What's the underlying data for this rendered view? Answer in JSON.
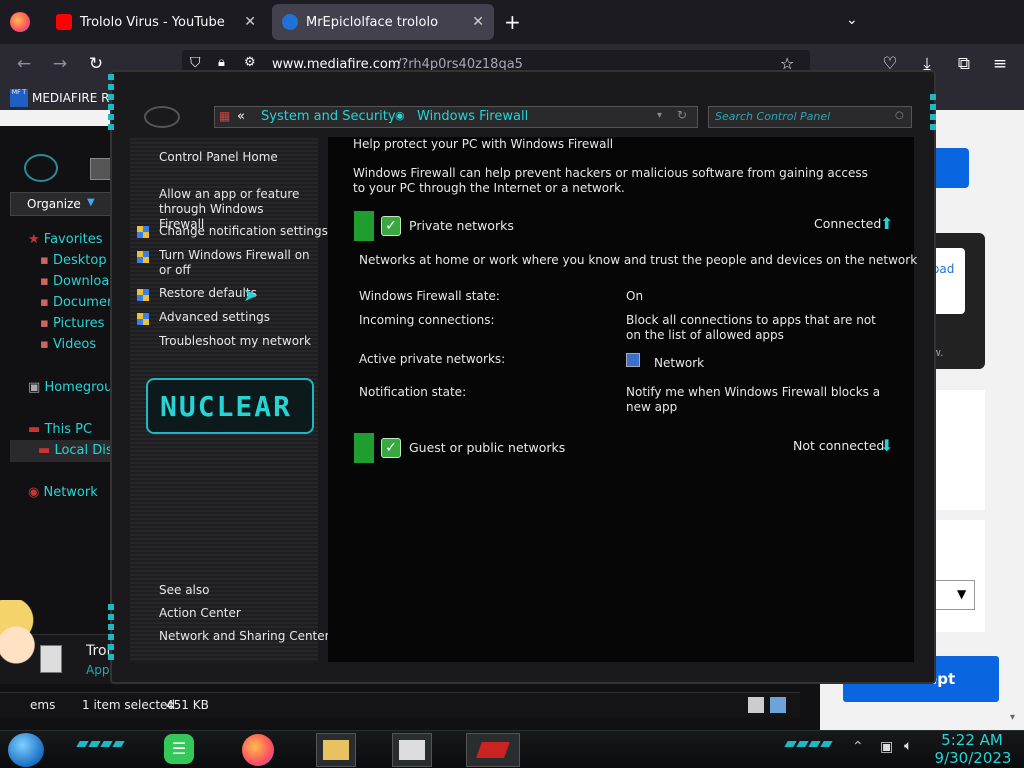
{
  "browser": {
    "tabs": [
      {
        "title": "Trololo Virus - YouTube",
        "icon": "youtube-icon",
        "active": false
      },
      {
        "title": "MrEpiclolface trololo",
        "icon": "mediafire-icon",
        "active": true
      }
    ],
    "url_domain": "www.mediafire.com",
    "url_path": "/?rh4p0rs40z18qa5",
    "bookmark": "MEDIAFIRE RO",
    "bookmark_icon": "MF T"
  },
  "explorer": {
    "organize": "Organize",
    "nav": [
      {
        "label": "Favorites",
        "icon": "star-icon"
      },
      {
        "label": "Desktop",
        "icon": "desktop-icon"
      },
      {
        "label": "Downloa",
        "icon": "download-icon"
      },
      {
        "label": "Documen",
        "icon": "document-icon"
      },
      {
        "label": "Pictures",
        "icon": "pictures-icon"
      },
      {
        "label": "Videos",
        "icon": "videos-icon"
      },
      {
        "label": "Homegroup",
        "icon": "homegroup-icon"
      },
      {
        "label": "This PC",
        "icon": "computer-icon"
      },
      {
        "label": "Local Dis",
        "icon": "drive-icon"
      },
      {
        "label": "Network",
        "icon": "network-icon"
      }
    ],
    "file_name": "Trol",
    "file_type": "Applic",
    "status_items": "ems",
    "status_selected": "1 item selected",
    "status_size": "451 KB"
  },
  "website": {
    "link_fragment": "oad",
    "text_fragment": "w.",
    "accept_label": "I Accept"
  },
  "control_panel": {
    "breadcrumb": [
      "System and Security",
      "Windows Firewall"
    ],
    "breadcrumb_sep": "«",
    "search_placeholder": "Search Control Panel",
    "left_links": {
      "home": "Control Panel Home",
      "allow_app": "Allow an app or feature through Windows Firewall",
      "change_notif": "Change notification settings",
      "turn_on_off": "Turn Windows Firewall on or off",
      "restore": "Restore defaults",
      "advanced": "Advanced settings",
      "troubleshoot": "Troubleshoot my network"
    },
    "logo_text": "NUCLEAR",
    "see_also": "See also",
    "see_also_links": [
      "Action Center",
      "Network and Sharing Center"
    ],
    "main": {
      "heading": "Help protect your PC with Windows Firewall",
      "description": "Windows Firewall can help prevent hackers or malicious software from gaining access to your PC through the Internet or a network.",
      "private": {
        "title": "Private networks",
        "status": "Connected",
        "desc": "Networks at home or work where you know and trust the people and devices on the network",
        "rows": [
          {
            "label": "Windows Firewall state:",
            "value": "On"
          },
          {
            "label": "Incoming connections:",
            "value": "Block all connections to apps that are not on the list of allowed apps"
          },
          {
            "label": "Active private networks:",
            "value": "Network"
          },
          {
            "label": "Notification state:",
            "value": "Notify me when Windows Firewall blocks a new app"
          }
        ]
      },
      "public": {
        "title": "Guest or public networks",
        "status": "Not connected"
      }
    }
  },
  "taskbar": {
    "time": "5:22 AM",
    "date": "9/30/2023"
  },
  "colors": {
    "accent": "#28d3d3",
    "green": "#1f9d2e",
    "accept": "#0a66e0"
  }
}
